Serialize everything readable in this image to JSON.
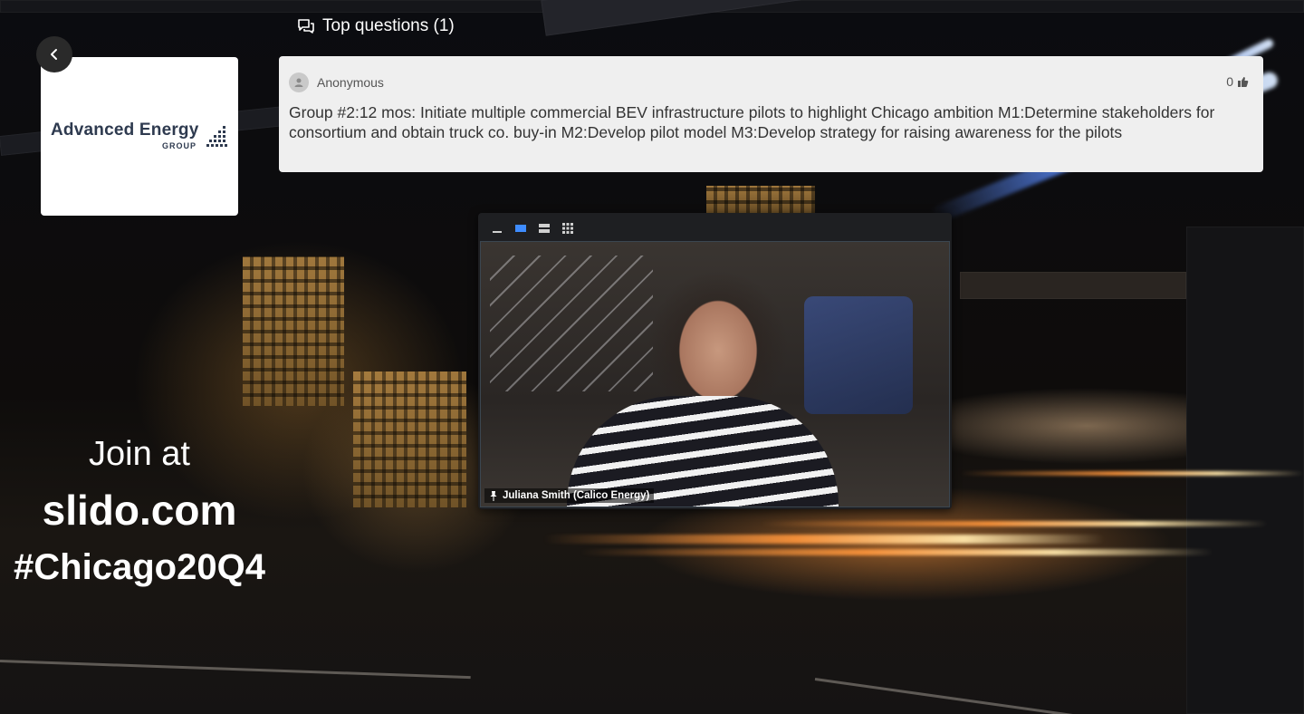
{
  "nav": {
    "back_icon": "chevron-left-icon"
  },
  "logo": {
    "name": "Advanced Energy",
    "sub": "GROUP",
    "icon": "dot-grid-logo"
  },
  "top_questions": {
    "header_icon": "chat-bubbles-icon",
    "label": "Top questions (1)",
    "questions": [
      {
        "author": "Anonymous",
        "votes": "0",
        "vote_icon": "thumbs-up-icon",
        "text": "Group #2:12 mos: Initiate multiple commercial BEV infrastructure pilots to highlight Chicago ambition M1:Determine stakeholders for consortium and obtain truck co. buy-in M2:Develop pilot model M3:Develop strategy for raising awareness for the pilots"
      }
    ]
  },
  "video": {
    "layout_buttons": [
      "minimize-icon",
      "speaker-view-icon",
      "split-view-icon",
      "gallery-view-icon"
    ],
    "active_layout": "speaker-view-icon",
    "accent": "#3e8cff",
    "participant": "Juliana Smith (Calico Energy)",
    "pin_icon": "pin-icon"
  },
  "join": {
    "line1": "Join at",
    "line2": "slido.com",
    "line3": "#Chicago20Q4"
  }
}
